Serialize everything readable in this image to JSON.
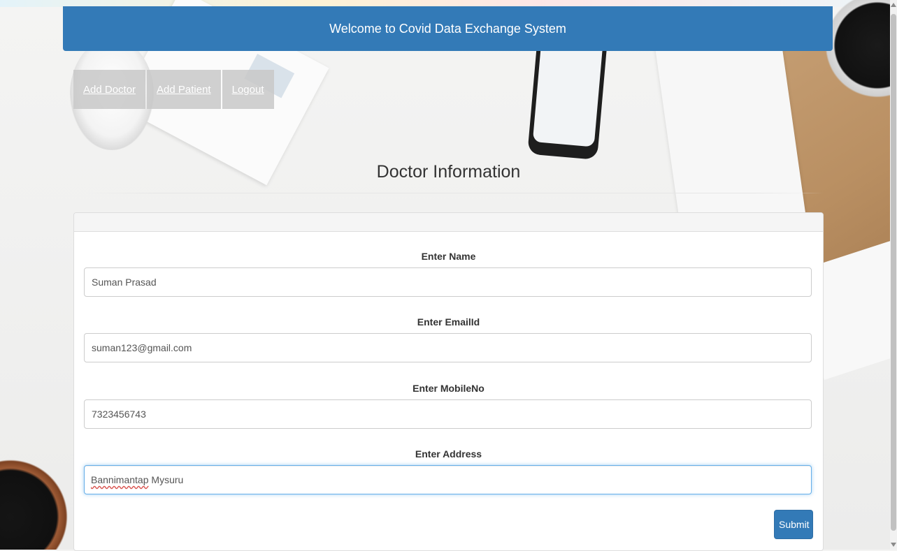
{
  "header": {
    "title": "Welcome to Covid Data Exchange System"
  },
  "nav": {
    "items": [
      {
        "label": "Add Doctor"
      },
      {
        "label": "Add Patient"
      },
      {
        "label": "Logout"
      }
    ]
  },
  "page": {
    "title": "Doctor Information"
  },
  "form": {
    "name": {
      "label": "Enter Name",
      "value": "Suman Prasad"
    },
    "email": {
      "label": "Enter EmailId",
      "value": "suman123@gmail.com"
    },
    "mobile": {
      "label": "Enter MobileNo",
      "value": "7323456743"
    },
    "address": {
      "label": "Enter Address",
      "value": "Bannimantap Mysuru",
      "misspelled_word": "Bannimantap",
      "rest": " Mysuru"
    },
    "submit_label": "Submit"
  },
  "colors": {
    "primary": "#337ab7",
    "focus_border": "#66afe9",
    "spellcheck": "#d9534f"
  }
}
